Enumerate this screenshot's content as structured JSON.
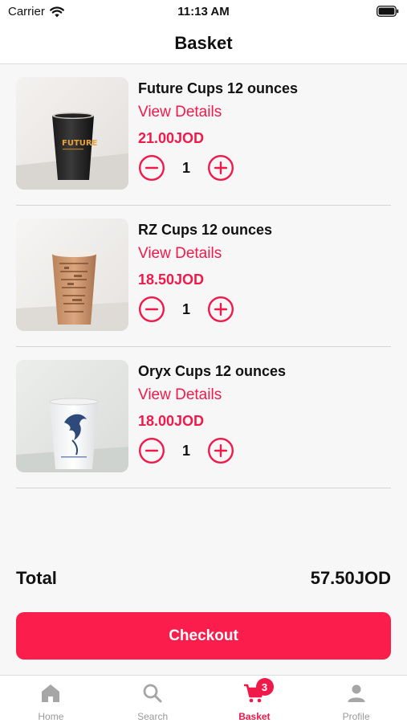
{
  "status_bar": {
    "carrier": "Carrier",
    "time": "11:13 AM"
  },
  "header": {
    "title": "Basket"
  },
  "items": [
    {
      "name": "Future Cups 12 ounces",
      "details_label": "View Details",
      "price": "21.00JOD",
      "quantity": "1",
      "image_icon": "black-paper-cup-image",
      "cup_logo_text": "FUTURE"
    },
    {
      "name": "RZ Cups 12 ounces",
      "details_label": "View Details",
      "price": "18.50JOD",
      "quantity": "1",
      "image_icon": "brown-coffee-print-cup-image"
    },
    {
      "name": "Oryx Cups 12 ounces",
      "details_label": "View Details",
      "price": "18.00JOD",
      "quantity": "1",
      "image_icon": "white-horse-print-cup-image"
    }
  ],
  "summary": {
    "total_label": "Total",
    "total_value": "57.50JOD"
  },
  "checkout_label": "Checkout",
  "tabbar": {
    "tabs": [
      {
        "label": "Home",
        "icon": "home-icon"
      },
      {
        "label": "Search",
        "icon": "search-icon"
      },
      {
        "label": "Basket",
        "icon": "cart-icon",
        "active": true,
        "badge": "3"
      },
      {
        "label": "Profile",
        "icon": "profile-icon"
      }
    ]
  },
  "colors": {
    "accent": "#f0194a",
    "checkout_bg": "#fb1d4b",
    "inactive_tab": "#999999"
  }
}
